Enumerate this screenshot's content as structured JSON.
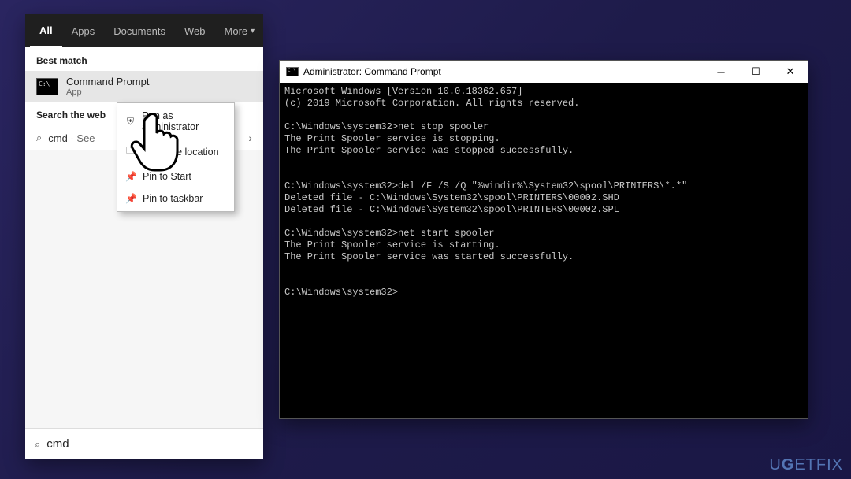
{
  "start_menu": {
    "tabs": [
      "All",
      "Apps",
      "Documents",
      "Web",
      "More"
    ],
    "active_tab": 0,
    "best_match_label": "Best match",
    "result": {
      "title": "Command Prompt",
      "subtitle": "App"
    },
    "web_section_label": "Search the web",
    "web_query_prefix": "cmd",
    "web_query_suffix": " - See",
    "search_value": "cmd"
  },
  "context_menu": {
    "items": [
      {
        "icon": "admin-icon",
        "glyph": "⛨",
        "label": "Run as administrator"
      },
      {
        "icon": "folder-icon",
        "glyph": "🗀",
        "label": "Open file location"
      },
      {
        "icon": "pin-start-icon",
        "glyph": "📌",
        "label": "Pin to Start"
      },
      {
        "icon": "pin-taskbar-icon",
        "glyph": "📌",
        "label": "Pin to taskbar"
      }
    ]
  },
  "cmd_window": {
    "title": "Administrator: Command Prompt",
    "lines": [
      "Microsoft Windows [Version 10.0.18362.657]",
      "(c) 2019 Microsoft Corporation. All rights reserved.",
      "",
      "C:\\Windows\\system32>net stop spooler",
      "The Print Spooler service is stopping.",
      "The Print Spooler service was stopped successfully.",
      "",
      "",
      "C:\\Windows\\system32>del /F /S /Q \"%windir%\\System32\\spool\\PRINTERS\\*.*\"",
      "Deleted file - C:\\Windows\\System32\\spool\\PRINTERS\\00002.SHD",
      "Deleted file - C:\\Windows\\System32\\spool\\PRINTERS\\00002.SPL",
      "",
      "C:\\Windows\\system32>net start spooler",
      "The Print Spooler service is starting.",
      "The Print Spooler service was started successfully.",
      "",
      "",
      "C:\\Windows\\system32>"
    ]
  },
  "watermark": {
    "text_a": "U",
    "text_b": "G",
    "text_c": "ETFIX"
  }
}
